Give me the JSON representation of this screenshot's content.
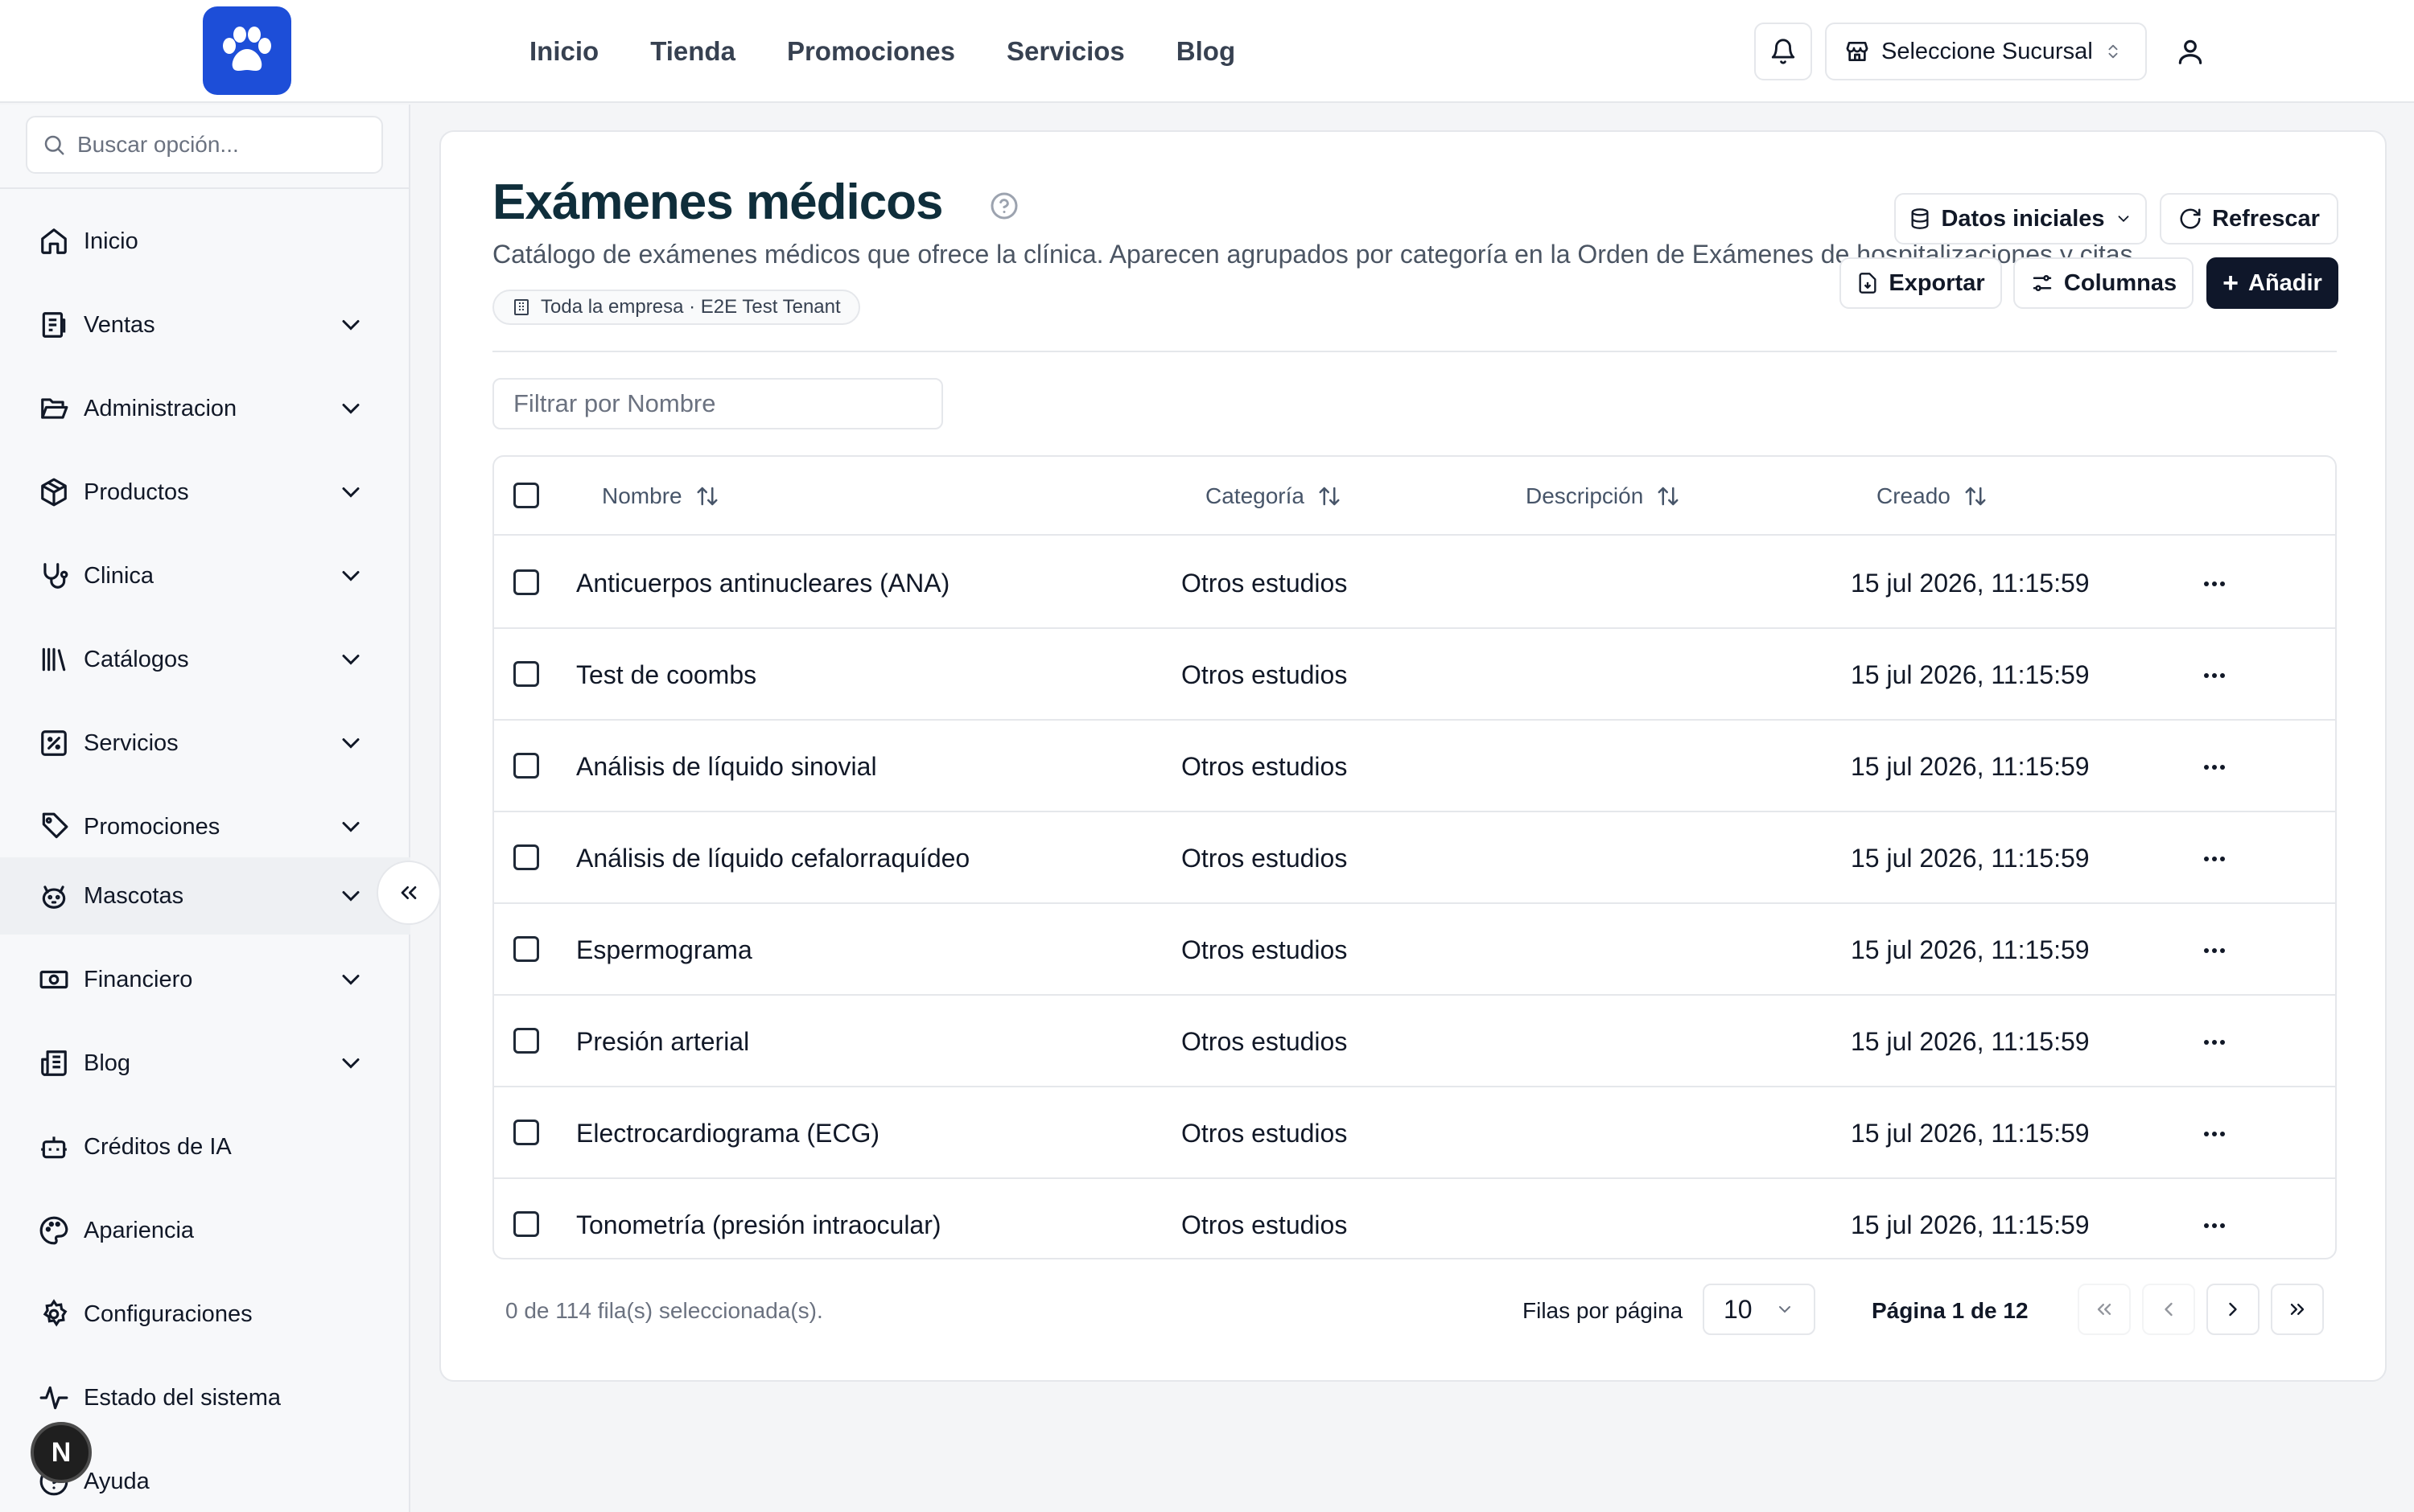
{
  "topbar": {
    "nav": [
      "Inicio",
      "Tienda",
      "Promociones",
      "Servicios",
      "Blog"
    ],
    "branch_label": "Seleccione Sucursal"
  },
  "sidebar": {
    "search_placeholder": "Buscar opción...",
    "items": [
      {
        "label": "Inicio",
        "icon": "home-icon",
        "expandable": false
      },
      {
        "label": "Ventas",
        "icon": "receipt-icon",
        "expandable": true
      },
      {
        "label": "Administracion",
        "icon": "folder-open-icon",
        "expandable": true
      },
      {
        "label": "Productos",
        "icon": "package-icon",
        "expandable": true
      },
      {
        "label": "Clinica",
        "icon": "stethoscope-icon",
        "expandable": true
      },
      {
        "label": "Catálogos",
        "icon": "library-icon",
        "expandable": true
      },
      {
        "label": "Servicios",
        "icon": "square-percent-icon",
        "expandable": true
      },
      {
        "label": "Promociones",
        "icon": "tag-icon",
        "expandable": true
      },
      {
        "label": "Mascotas",
        "icon": "pet-face-icon",
        "expandable": true,
        "active": true
      },
      {
        "label": "Financiero",
        "icon": "banknote-icon",
        "expandable": true
      },
      {
        "label": "Blog",
        "icon": "newspaper-icon",
        "expandable": true
      },
      {
        "label": "Créditos de IA",
        "icon": "bot-icon",
        "expandable": false
      },
      {
        "label": "Apariencia",
        "icon": "palette-icon",
        "expandable": false
      },
      {
        "label": "Configuraciones",
        "icon": "settings-icon",
        "expandable": false
      },
      {
        "label": "Estado del sistema",
        "icon": "activity-icon",
        "expandable": false
      },
      {
        "label": "Ayuda",
        "icon": "help-circle-icon",
        "expandable": false
      }
    ],
    "badge_letter": "N"
  },
  "page": {
    "title": "Exámenes médicos",
    "description": "Catálogo de exámenes médicos que ofrece la clínica. Aparecen agrupados por categoría en la Orden de Exámenes de hospitalizaciones y citas.",
    "scope": "Toda la empresa · E2E Test Tenant",
    "buttons": {
      "initial_data": "Datos iniciales",
      "refresh": "Refrescar",
      "export": "Exportar",
      "columns": "Columnas",
      "add": "Añadir"
    },
    "filter_placeholder": "Filtrar por Nombre"
  },
  "table": {
    "columns": [
      "Nombre",
      "Categoría",
      "Descripción",
      "Creado"
    ],
    "rows": [
      {
        "name": "Anticuerpos antinucleares (ANA)",
        "category": "Otros estudios",
        "description": "",
        "created": "15 jul 2026, 11:15:59"
      },
      {
        "name": "Test de coombs",
        "category": "Otros estudios",
        "description": "",
        "created": "15 jul 2026, 11:15:59"
      },
      {
        "name": "Análisis de líquido sinovial",
        "category": "Otros estudios",
        "description": "",
        "created": "15 jul 2026, 11:15:59"
      },
      {
        "name": "Análisis de líquido cefalorraquídeo",
        "category": "Otros estudios",
        "description": "",
        "created": "15 jul 2026, 11:15:59"
      },
      {
        "name": "Espermograma",
        "category": "Otros estudios",
        "description": "",
        "created": "15 jul 2026, 11:15:59"
      },
      {
        "name": "Presión arterial",
        "category": "Otros estudios",
        "description": "",
        "created": "15 jul 2026, 11:15:59"
      },
      {
        "name": "Electrocardiograma (ECG)",
        "category": "Otros estudios",
        "description": "",
        "created": "15 jul 2026, 11:15:59"
      },
      {
        "name": "Tonometría (presión intraocular)",
        "category": "Otros estudios",
        "description": "",
        "created": "15 jul 2026, 11:15:59"
      }
    ]
  },
  "footer": {
    "selected": "0 de 114 fila(s) seleccionada(s).",
    "rows_per_page_label": "Filas por página",
    "rows_per_page_value": "10",
    "page_label": "Página 1 de 12"
  },
  "colors": {
    "brand": "#1d4ed8",
    "primary_button": "#0f172a",
    "title": "#0f2e3b"
  }
}
